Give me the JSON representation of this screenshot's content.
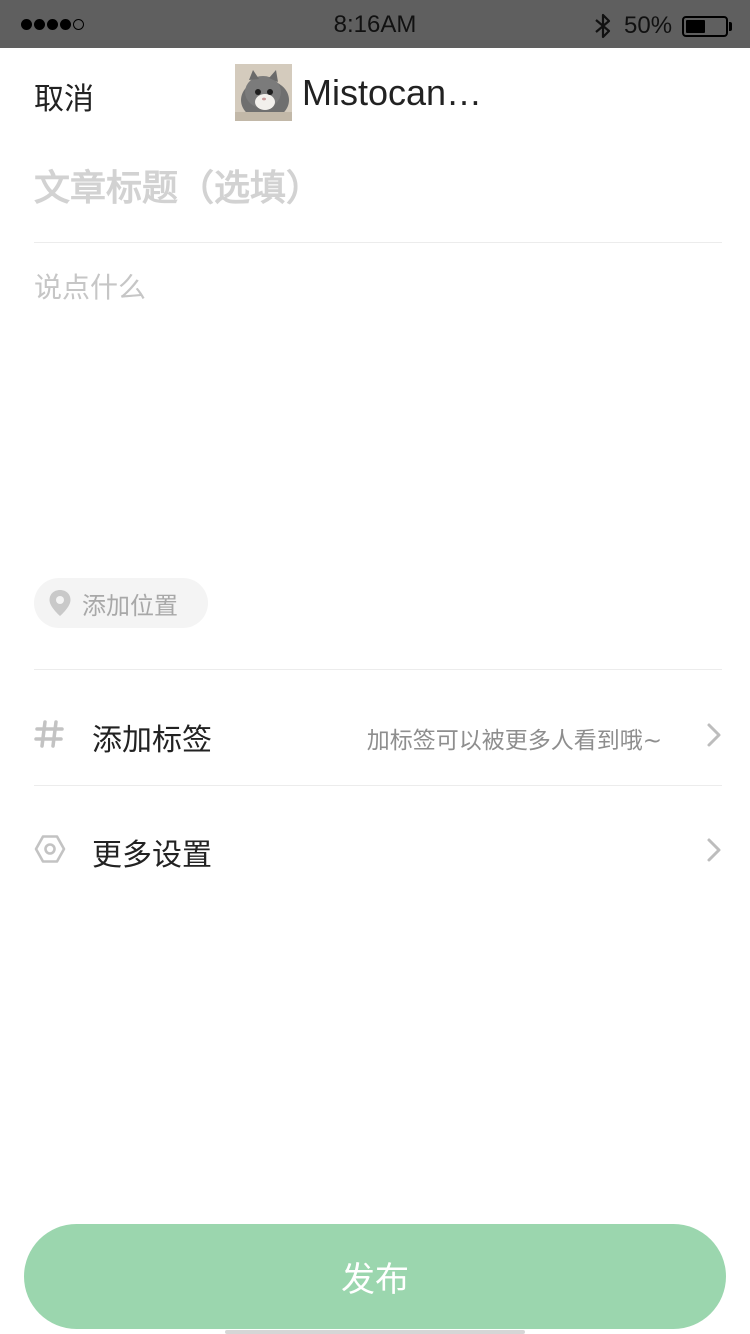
{
  "status_bar": {
    "time": "8:16AM",
    "battery_percent": "50%",
    "battery_level": 0.5,
    "signal_bars_filled": 4,
    "signal_bars_total": 5,
    "icons": [
      "signal-dots-icon",
      "bluetooth-icon",
      "battery-icon"
    ]
  },
  "header": {
    "cancel_label": "取消",
    "username": "Mistocan…",
    "avatar_icon": "cat-avatar-icon"
  },
  "composer": {
    "title_placeholder": "文章标题（选填）",
    "title_value": "",
    "body_placeholder": "说点什么",
    "body_value": ""
  },
  "location": {
    "label": "添加位置",
    "icon": "location-pin-icon"
  },
  "options": {
    "tags": {
      "label": "添加标签",
      "hint": "加标签可以被更多人看到哦~",
      "icon": "hashtag-icon"
    },
    "settings": {
      "label": "更多设置",
      "icon": "hexagon-settings-icon"
    }
  },
  "publish": {
    "label": "发布"
  },
  "colors": {
    "accent": "#9bd6ae",
    "status_bar_bg": "#5f5f5f",
    "placeholder": "#d2d2d2",
    "divider": "#ececec"
  }
}
